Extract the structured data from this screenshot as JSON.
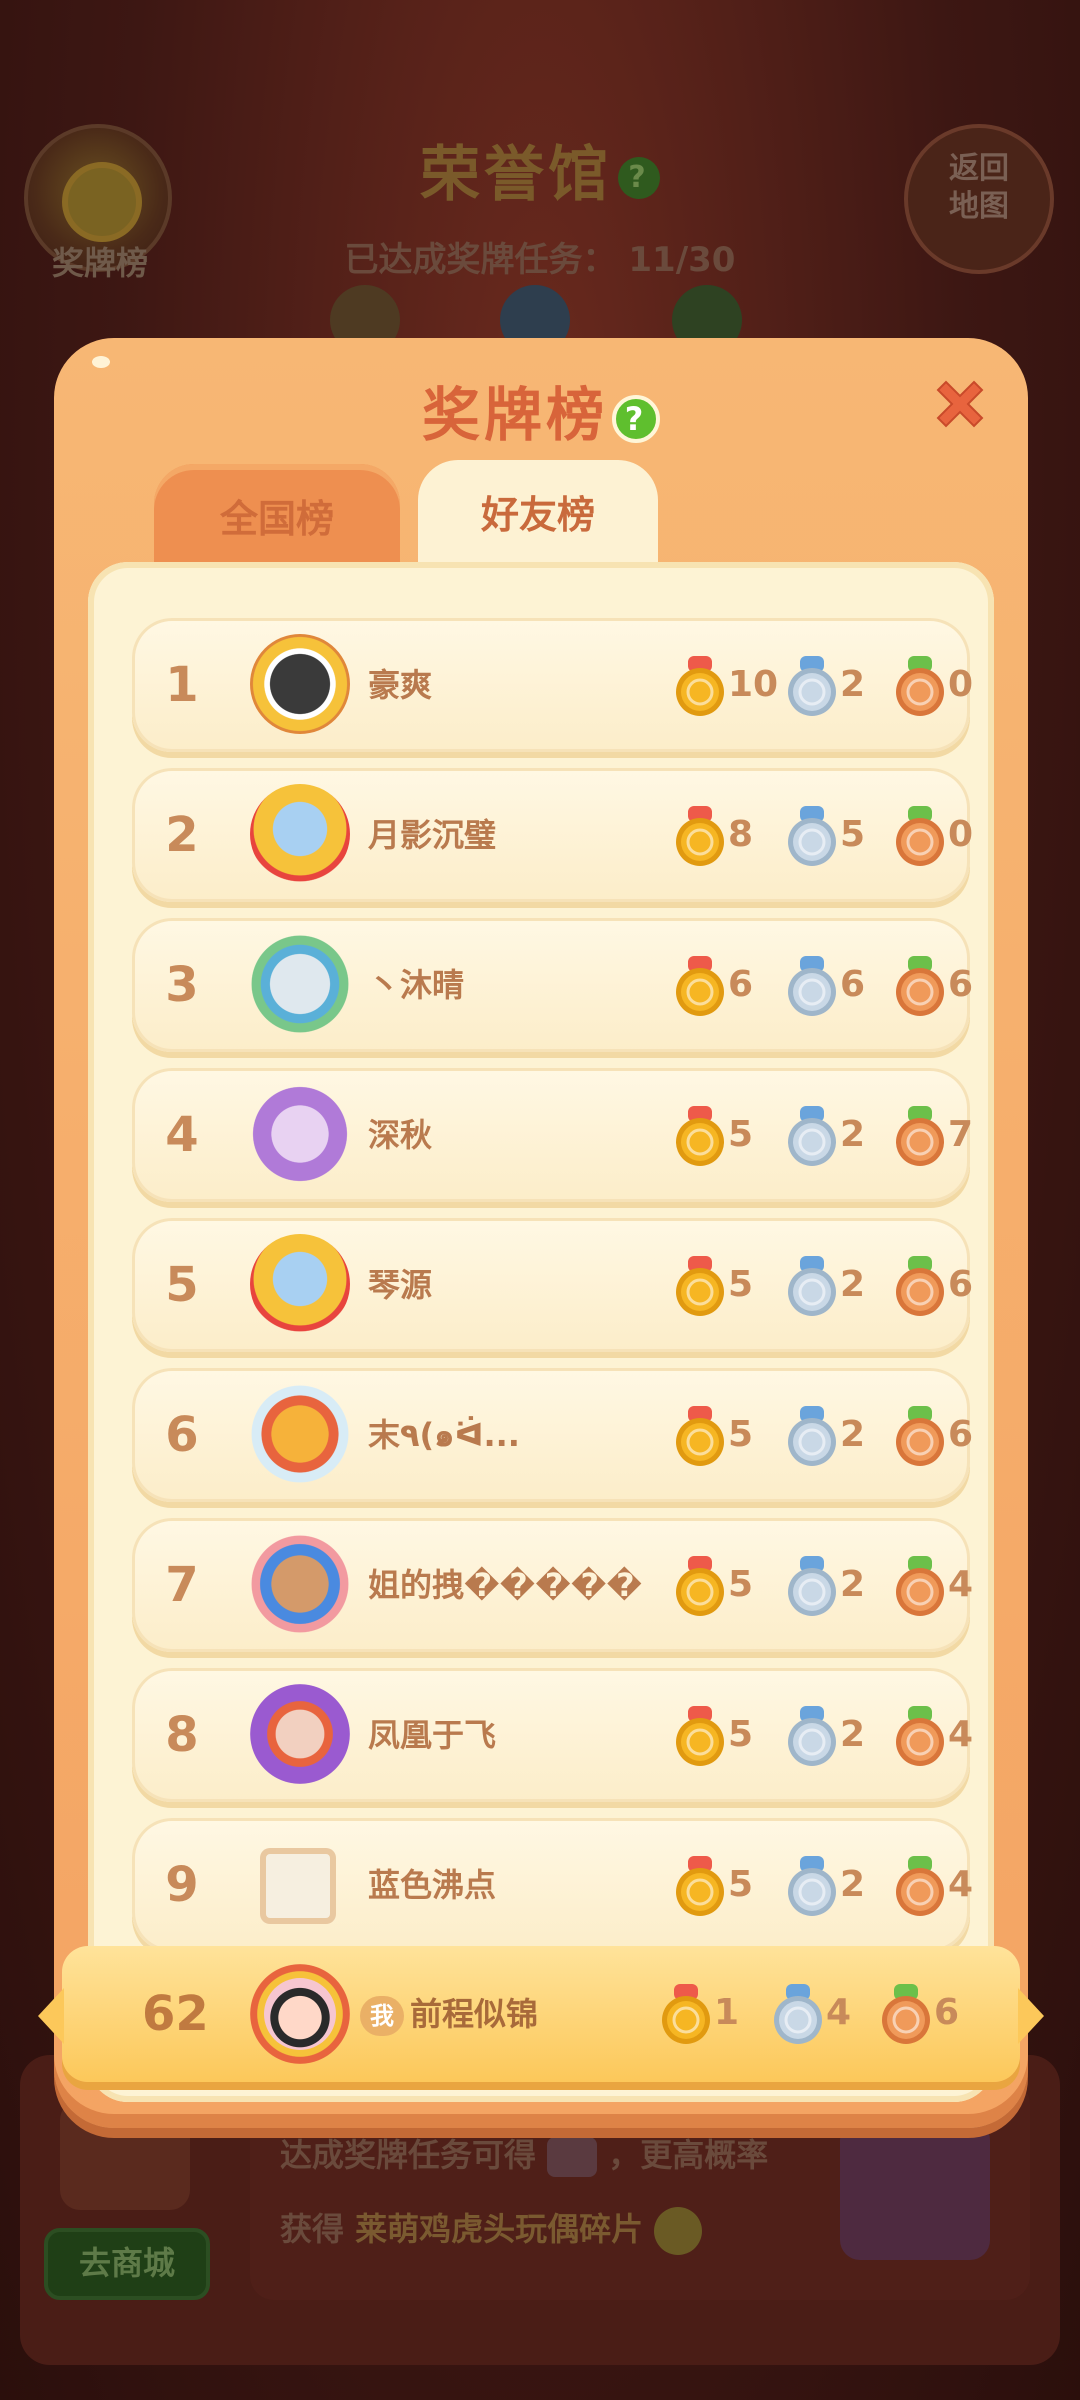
{
  "background": {
    "medal_board_label": "奖牌榜",
    "hall_title": "荣誉馆",
    "hall_help": "?",
    "progress_label": "已达成奖牌任务：",
    "progress_value": "11/30",
    "return_label_line1": "返回",
    "return_label_line2": "地图",
    "shop_button": "去商城",
    "info_line1": "达成奖牌任务可得",
    "info_line1_suffix": "，更高概率",
    "info_line2_prefix": "获得",
    "info_line2_item": "莱萌鸡虎头玩偶碎片"
  },
  "dialog": {
    "title": "奖牌榜",
    "help": "?",
    "tabs": [
      {
        "label": "全国榜",
        "active": false
      },
      {
        "label": "好友榜",
        "active": true
      }
    ]
  },
  "colors": {
    "gold": "#f6b623",
    "silver": "#c9d8e6",
    "bronze": "#f09a5a",
    "gold_ribbon": "#ee5a4a",
    "silver_ribbon": "#6aa4dc",
    "bronze_ribbon": "#6cc04a"
  },
  "leaderboard": [
    {
      "rank": "1",
      "name": "豪爽",
      "gold": "10",
      "silver": "2",
      "bronze": "0",
      "avatar": "chick-frame-photo-avatar"
    },
    {
      "rank": "2",
      "name": "月影沉璧",
      "gold": "8",
      "silver": "5",
      "bronze": "0",
      "avatar": "chick-4000-avatar"
    },
    {
      "rank": "3",
      "name": "丶沐晴",
      "gold": "6",
      "silver": "6",
      "bronze": "6",
      "avatar": "lotus-photo-avatar"
    },
    {
      "rank": "4",
      "name": "深秋",
      "gold": "5",
      "silver": "2",
      "bronze": "7",
      "avatar": "guitar-avatar"
    },
    {
      "rank": "5",
      "name": "琴源",
      "gold": "5",
      "silver": "2",
      "bronze": "6",
      "avatar": "chick-4000-avatar"
    },
    {
      "rank": "6",
      "name": "末٩(๑ᐛ...",
      "gold": "5",
      "silver": "2",
      "bronze": "6",
      "avatar": "chick-snow-avatar"
    },
    {
      "rank": "7",
      "name": "姐的拽�����",
      "gold": "5",
      "silver": "2",
      "bronze": "4",
      "avatar": "horse-lotus-avatar"
    },
    {
      "rank": "8",
      "name": "凤凰于飞",
      "gold": "5",
      "silver": "2",
      "bronze": "4",
      "avatar": "purple-chick-avatar"
    },
    {
      "rank": "9",
      "name": "蓝色沸点",
      "gold": "5",
      "silver": "2",
      "bronze": "4",
      "avatar": "chick-square-avatar"
    }
  ],
  "me": {
    "rank": "62",
    "tag": "我",
    "name": "前程似锦",
    "gold": "1",
    "silver": "4",
    "bronze": "6",
    "avatar": "cartoon-girl-avatar"
  }
}
